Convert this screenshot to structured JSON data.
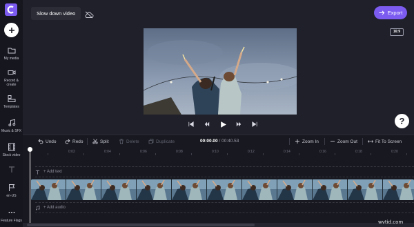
{
  "app": {
    "logo_icon": "clipchamp-logo-icon"
  },
  "sidebar": {
    "add_icon": "plus-icon",
    "items": [
      {
        "label": "My media",
        "icon": "folder-icon"
      },
      {
        "label": "Record &\ncreate",
        "icon": "video-camera-icon"
      },
      {
        "label": "Templates",
        "icon": "templates-icon"
      },
      {
        "label": "Music & SFX",
        "icon": "music-note-icon"
      },
      {
        "label": "Stock video",
        "icon": "film-icon"
      },
      {
        "label": "",
        "icon": "text-icon"
      },
      {
        "label": "en-US",
        "icon": "flag-icon"
      },
      {
        "label": "Feature Flags",
        "icon": "more-dots-icon"
      }
    ]
  },
  "header": {
    "project_title": "Slow down video",
    "cloud_status_icon": "cloud-off-icon",
    "export_label": "Export",
    "export_icon": "arrow-right-icon",
    "aspect_ratio": "16:9"
  },
  "player": {
    "controls": [
      "skip-to-start-icon",
      "rewind-icon",
      "play-icon",
      "fast-forward-icon",
      "skip-to-end-icon"
    ],
    "help_label": "?"
  },
  "toolbar": {
    "undo": "Undo",
    "redo": "Redo",
    "split": "Split",
    "delete": "Delete",
    "duplicate": "Duplicate",
    "current_time": "00:00.00",
    "separator": " / ",
    "duration": "00:40.53",
    "zoom_in": "Zoom In",
    "zoom_out": "Zoom Out",
    "fit": "Fit To Screen"
  },
  "timeline": {
    "ticks": [
      "0:02",
      "0:04",
      "0:06",
      "0:08",
      "0:10",
      "0:12",
      "0:14",
      "0:16",
      "0:18",
      "0:20"
    ],
    "add_text": "+ Add text",
    "add_audio": "+ Add audio"
  },
  "colors": {
    "accent": "#7c5cf0",
    "background": "#1f2029",
    "sidebar": "#15161e",
    "track": "#2d6b7a"
  },
  "watermark": "wvtid.com"
}
